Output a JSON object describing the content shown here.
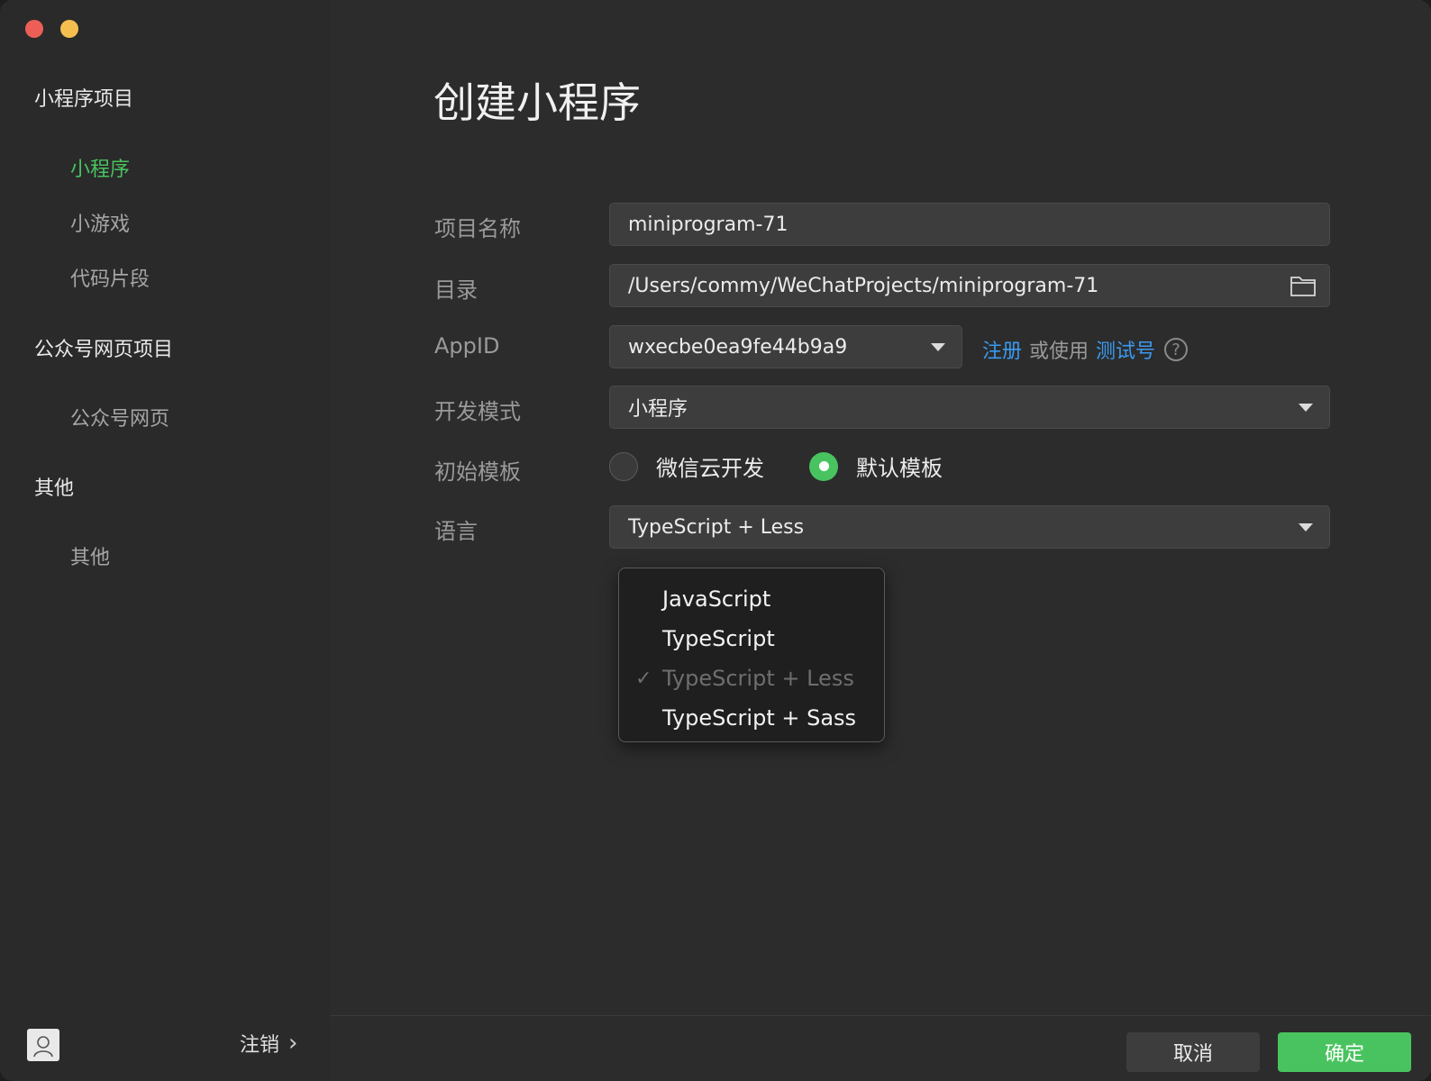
{
  "window": {
    "title": "创建小程序"
  },
  "sidebar": {
    "sections": [
      {
        "title": "小程序项目",
        "items": [
          "小程序",
          "小游戏",
          "代码片段"
        ]
      },
      {
        "title": "公众号网页项目",
        "items": [
          "公众号网页"
        ]
      },
      {
        "title": "其他",
        "items": [
          "其他"
        ]
      }
    ],
    "active_item": "小程序",
    "logout_label": "注销",
    "logout_chevron": "›"
  },
  "form": {
    "project_name": {
      "label": "项目名称",
      "value": "miniprogram-71"
    },
    "directory": {
      "label": "目录",
      "value": "/Users/commy/WeChatProjects/miniprogram-71"
    },
    "appid": {
      "label": "AppID",
      "value": "wxecbe0ea9fe44b9a9",
      "register_link": "注册",
      "or_use": "或使用",
      "test_account_link": "测试号",
      "help": "?"
    },
    "dev_mode": {
      "label": "开发模式",
      "value": "小程序"
    },
    "template": {
      "label": "初始模板",
      "options": [
        "微信云开发",
        "默认模板"
      ],
      "selected": "默认模板"
    },
    "language": {
      "label": "语言",
      "value": "TypeScript + Less",
      "options": [
        "JavaScript",
        "TypeScript",
        "TypeScript + Less",
        "TypeScript + Sass"
      ],
      "checked_mark": "✓"
    }
  },
  "footer": {
    "cancel_label": "取消",
    "confirm_label": "确定"
  },
  "colors": {
    "accent_green": "#49c35f",
    "link_blue": "#3a9af0",
    "background": "#2c2c2c"
  }
}
